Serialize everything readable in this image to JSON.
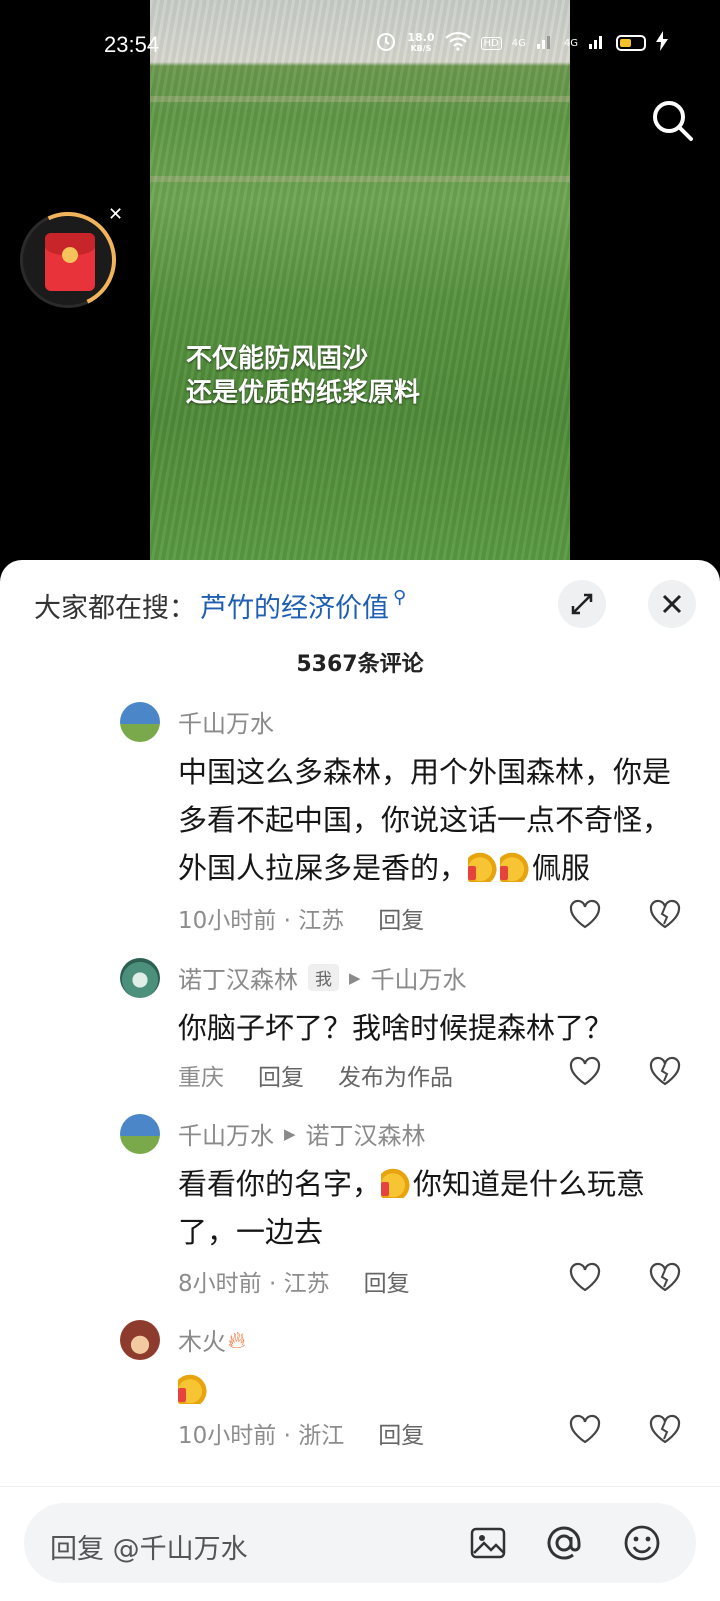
{
  "status_bar": {
    "time": "23:54",
    "net_speed_value": "18.0",
    "net_speed_unit": "KB/S",
    "hd": "HD",
    "signal1": "4G",
    "signal2": "4G"
  },
  "video": {
    "caption_line1": "不仅能防风固沙",
    "caption_line2": "还是优质的纸浆原料"
  },
  "sheet": {
    "search_prefix": "大家都在搜：",
    "search_term": "芦竹的经济价值",
    "comment_count": "5367条评论"
  },
  "comments": [
    {
      "user": "千山万水",
      "text_parts": [
        "中国这么多森林，用个外国森林，你是多看不起中国，你说这话一点不奇怪，外国人拉屎多是香的，",
        "佩服"
      ],
      "meta": "10小时前 · 江苏",
      "reply": "回复"
    },
    {
      "user": "诺丁汉森林",
      "tag": "我",
      "reply_to": "千山万水",
      "text": "你脑子坏了？我啥时候提森林了？",
      "meta": "重庆",
      "reply": "回复",
      "publish": "发布为作品"
    },
    {
      "user": "千山万水",
      "reply_to": "诺丁汉森林",
      "text_parts": [
        "看看你的名字，",
        "你知道是什么玩意了，一边去"
      ],
      "meta": "8小时前 · 江苏",
      "reply": "回复"
    },
    {
      "user": "木火",
      "meta": "10小时前 · 浙江",
      "reply": "回复"
    }
  ],
  "input": {
    "placeholder": "回复 @千山万水"
  },
  "colors": {
    "link": "#1f5fb3",
    "sheet_bg": "#ffffff",
    "accent_ring": "#f1b45b",
    "envelope": "#e8333a"
  },
  "icons": [
    "alarm-icon",
    "wifi-icon",
    "signal-icon",
    "battery-icon",
    "charging-icon",
    "search-icon",
    "expand-icon",
    "close-icon",
    "heart-icon",
    "broken-heart-icon",
    "image-icon",
    "at-icon",
    "emoji-icon",
    "red-envelope-icon",
    "fire-icon",
    "thumbs-up-icon"
  ]
}
